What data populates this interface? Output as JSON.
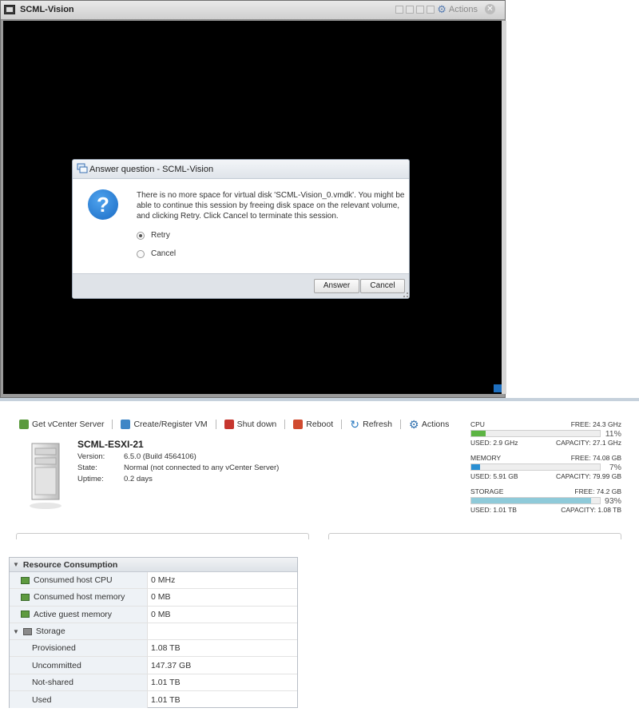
{
  "console": {
    "title": "SCML-Vision",
    "actions_label": "Actions",
    "actions_icon": "gear-icon",
    "close_icon": "close-icon"
  },
  "dialog": {
    "title": "Answer question - SCML-Vision",
    "message": "There is no more space for virtual disk 'SCML-Vision_0.vmdk'. You might be able to continue this session by freeing disk space on the relevant volume, and clicking Retry. Click Cancel to terminate this session.",
    "options": [
      {
        "label": "Retry",
        "selected": true
      },
      {
        "label": "Cancel",
        "selected": false
      }
    ],
    "answer_button": "Answer",
    "cancel_button": "Cancel"
  },
  "toolbar": {
    "get_vcenter": "Get vCenter Server",
    "create_register": "Create/Register VM",
    "shut_down": "Shut down",
    "reboot": "Reboot",
    "refresh": "Refresh",
    "actions": "Actions"
  },
  "host": {
    "name": "SCML-ESXI-21",
    "version_label": "Version:",
    "version": "6.5.0 (Build 4564106)",
    "state_label": "State:",
    "state": "Normal (not connected to any vCenter Server)",
    "uptime_label": "Uptime:",
    "uptime": "0.2 days"
  },
  "meters": {
    "cpu": {
      "label": "CPU",
      "free": "FREE: 24.3 GHz",
      "percent": "11%",
      "fill": 0.11,
      "used": "USED: 2.9 GHz",
      "capacity": "CAPACITY: 27.1 GHz",
      "color": "#5cb443"
    },
    "memory": {
      "label": "MEMORY",
      "free": "FREE: 74.08 GB",
      "percent": "7%",
      "fill": 0.07,
      "used": "USED: 5.91 GB",
      "capacity": "CAPACITY: 79.99 GB",
      "color": "#2a8fd3"
    },
    "storage": {
      "label": "STORAGE",
      "free": "FREE: 74.2 GB",
      "percent": "93%",
      "fill": 0.93,
      "used": "USED: 1.01 TB",
      "capacity": "CAPACITY: 1.08 TB",
      "color": "#8fcad9"
    }
  },
  "resource": {
    "title": "Resource Consumption",
    "rows": [
      {
        "name": "Consumed host CPU",
        "value": "0 MHz"
      },
      {
        "name": "Consumed host memory",
        "value": "0 MB"
      },
      {
        "name": "Active guest memory",
        "value": "0 MB"
      },
      {
        "name": "Storage",
        "value": ""
      },
      {
        "name": "Provisioned",
        "value": "1.08 TB"
      },
      {
        "name": "Uncommitted",
        "value": "147.37 GB"
      },
      {
        "name": "Not-shared",
        "value": "1.01 TB"
      },
      {
        "name": "Used",
        "value": "1.01 TB"
      }
    ]
  }
}
